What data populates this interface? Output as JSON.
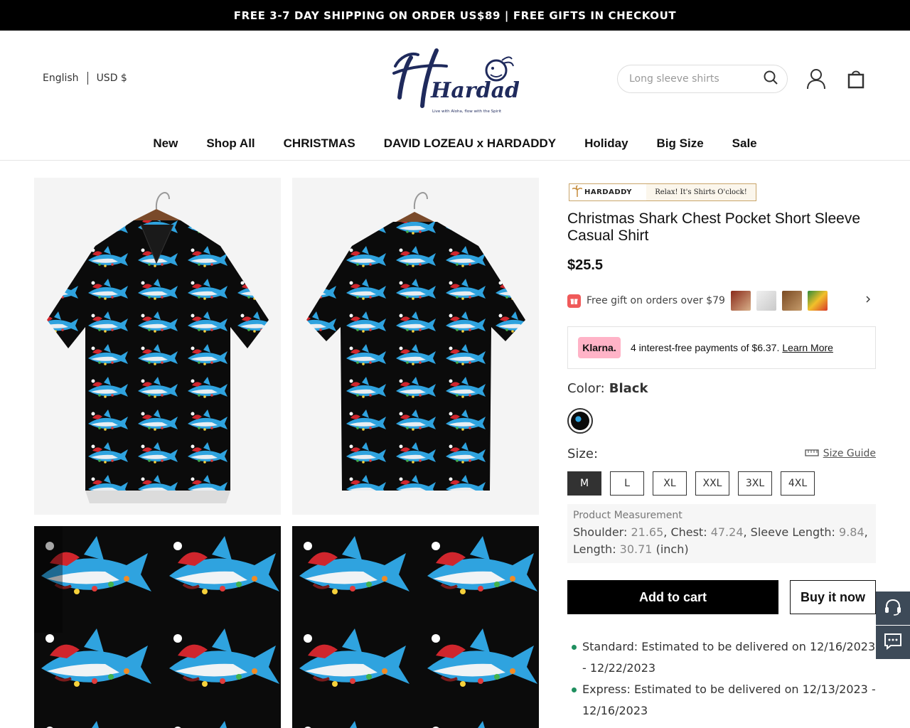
{
  "announcement": "FREE 3-7 DAY SHIPPING ON ORDER US$89 | FREE GIFTS IN CHECKOUT",
  "header": {
    "language": "English",
    "currency": "USD $",
    "logo_text": "Hardaddy",
    "logo_tagline": "Live with Aloha, flow with the Spirit",
    "search_placeholder": "Long sleeve shirts"
  },
  "nav": [
    "New",
    "Shop All",
    "CHRISTMAS",
    "DAVID LOZEAU x HARDADDY",
    "Holiday",
    "Big Size",
    "Sale"
  ],
  "product": {
    "brand_banner_left": "HARDADDY",
    "brand_banner_right": "Relax! It's Shirts O'clock!",
    "title": "Christmas Shark Chest Pocket Short Sleeve Casual Shirt",
    "price": "$25.5",
    "gift_text": "Free gift on orders over $79",
    "klarna_badge": "Klarna.",
    "klarna_text": "4 interest-free payments of $6.37.",
    "klarna_link": "Learn More",
    "color_label": "Color:",
    "color_value": "Black",
    "size_label": "Size:",
    "size_guide": "Size Guide",
    "sizes": [
      "M",
      "L",
      "XL",
      "XXL",
      "3XL",
      "4XL"
    ],
    "selected_size": "M",
    "measurement_title": "Product Measurement",
    "measurements": {
      "shoulder_label": "Shoulder:",
      "shoulder": "21.65",
      "chest_label": "Chest:",
      "chest": "47.24",
      "sleeve_label": "Sleeve Length:",
      "sleeve": "9.84",
      "length_label": "Length:",
      "length": "30.71",
      "unit": "(inch)"
    },
    "add_to_cart": "Add to cart",
    "buy_now": "Buy it now",
    "delivery": [
      "Standard: Estimated to be delivered on 12/16/2023 - 12/22/2023",
      "Express: Estimated to be delivered on 12/13/2023 - 12/16/2023"
    ]
  },
  "colors": {
    "topbar": "#000000",
    "brand_navy": "#1f2a5c",
    "klarna_pink": "#ffb3c7",
    "delivery_dot": "#1f8f5f",
    "side_tab": "#3d4a58"
  },
  "icons": [
    "search-icon",
    "user-icon",
    "bag-icon",
    "gift-icon",
    "chevron-right-icon",
    "ruler-icon",
    "headset-icon",
    "chat-icon"
  ]
}
